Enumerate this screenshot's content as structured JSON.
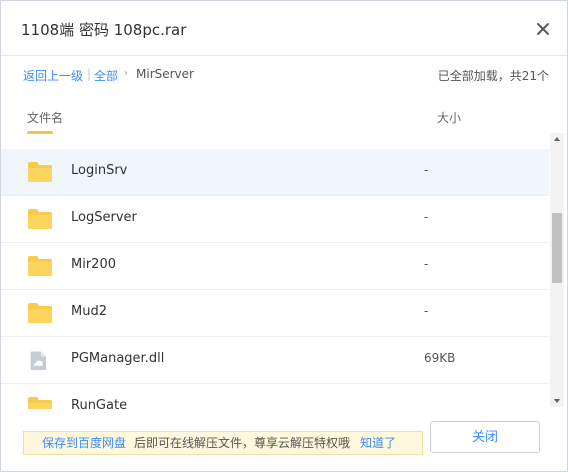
{
  "dialog": {
    "title": "1108端 密码 108pc.rar",
    "close_icon": "close-icon"
  },
  "breadcrumb": {
    "back_label": "返回上一级",
    "separator": "|",
    "root_label": "全部",
    "arrow": "›",
    "current_label": "MirServer"
  },
  "status": {
    "load_text": "已全部加载，共21个"
  },
  "columns": {
    "name": "文件名",
    "size": "大小"
  },
  "files": [
    {
      "name": "LoginSrv",
      "size": "-",
      "icon": "folder-icon",
      "selected": true
    },
    {
      "name": "LogServer",
      "size": "-",
      "icon": "folder-icon",
      "selected": false
    },
    {
      "name": "Mir200",
      "size": "-",
      "icon": "folder-icon",
      "selected": false
    },
    {
      "name": "Mud2",
      "size": "-",
      "icon": "folder-icon",
      "selected": false
    },
    {
      "name": "PGManager.dll",
      "size": "69KB",
      "icon": "file-icon",
      "selected": false
    },
    {
      "name": "RunGate",
      "size": "",
      "icon": "folder-icon",
      "selected": false
    }
  ],
  "footer": {
    "tip_link": "保存到百度网盘",
    "tip_text": "后即可在线解压文件，尊享云解压特权哦",
    "tip_ack": "知道了",
    "close_button": "关闭"
  },
  "colors": {
    "accent": "#3b8cff",
    "folder": "#f8c94b",
    "selected_row": "#f1f6fd",
    "tip_bg": "#fff8dc"
  }
}
